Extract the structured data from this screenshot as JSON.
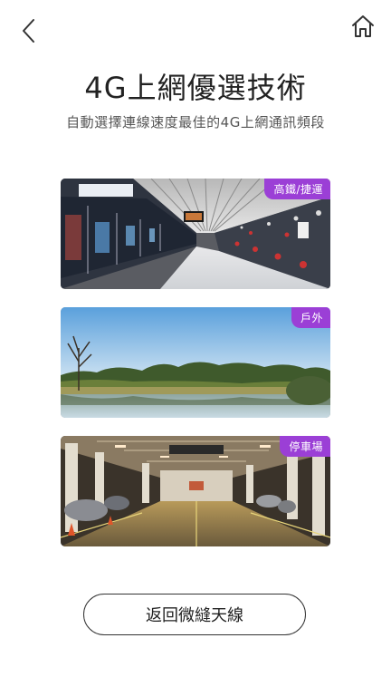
{
  "header": {
    "back_icon": "chevron-left-icon",
    "home_icon": "home-icon"
  },
  "main": {
    "title": "4G上網優選技術",
    "subtitle": "自動選擇連線速度最佳的4G上網通訊頻段",
    "scenes": [
      {
        "tag": "高鐵/捷運"
      },
      {
        "tag": "戶外"
      },
      {
        "tag": "停車場"
      }
    ]
  },
  "colors": {
    "tag_bg": "#9b3fd6"
  },
  "footer": {
    "return_label": "返回微縫天線"
  }
}
